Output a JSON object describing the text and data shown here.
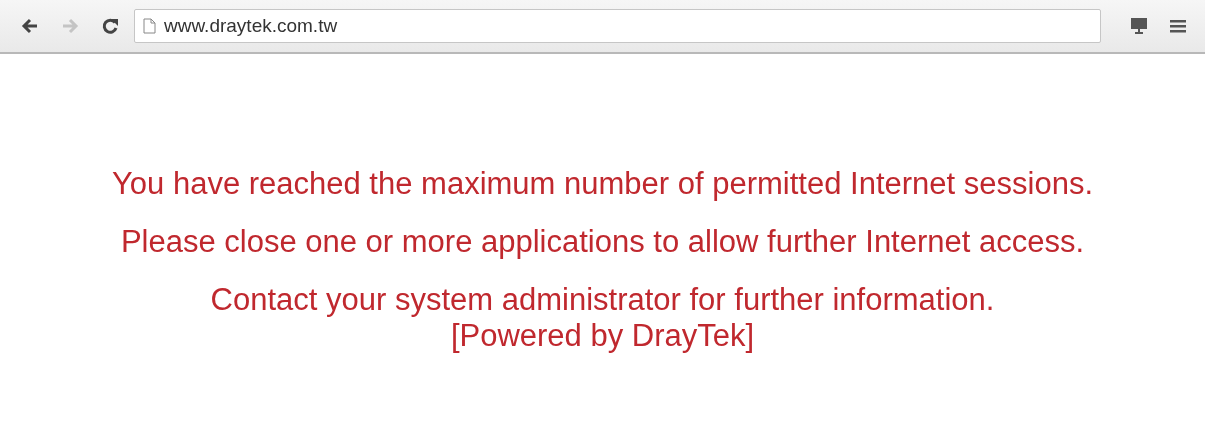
{
  "toolbar": {
    "nav_buttons": [
      {
        "kind": "back",
        "disabled": false
      },
      {
        "kind": "forward",
        "disabled": true
      },
      {
        "kind": "reload",
        "disabled": false
      }
    ],
    "address": "www.draytek.com.tw"
  },
  "paragraphs": [
    {
      "lines": [
        "You have reached the maximum number of permitted Internet sessions."
      ]
    },
    {
      "lines": [
        "Please close one or more applications to allow further Internet access."
      ]
    },
    {
      "lines": [
        "Contact your system administrator for further information.",
        "[Powered by DrayTek]"
      ]
    }
  ]
}
